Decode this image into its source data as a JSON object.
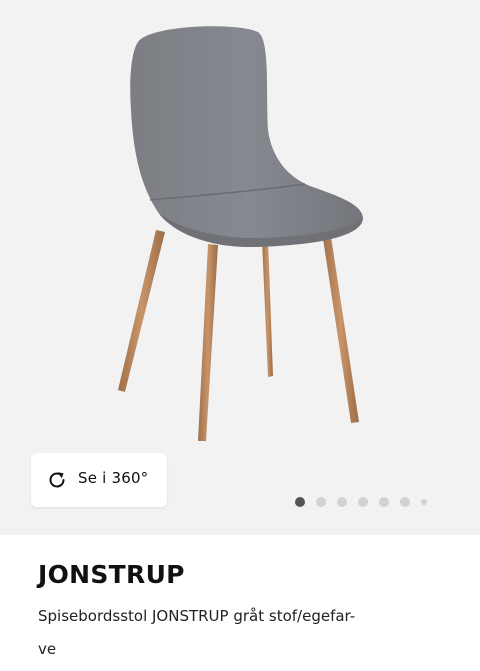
{
  "gallery": {
    "image_alt": "chair-image",
    "view_360_label": "Se i 360°",
    "view_360_icon": "rotate-icon",
    "dots": {
      "count": 7,
      "active_index": 0
    }
  },
  "product": {
    "name": "JONSTRUP",
    "description": "Spisebordsstol JONSTRUP gråt stof/egefar-ve",
    "description_line1": "Spisebordsstol JONSTRUP gråt stof/egefar-",
    "description_line2": "ve"
  },
  "colors": {
    "gallery_bg": "#f2f2f2",
    "fabric": "#7f8186",
    "wood": "#b88456",
    "dot_active": "#555555",
    "dot_inactive": "#d2d2d2"
  }
}
